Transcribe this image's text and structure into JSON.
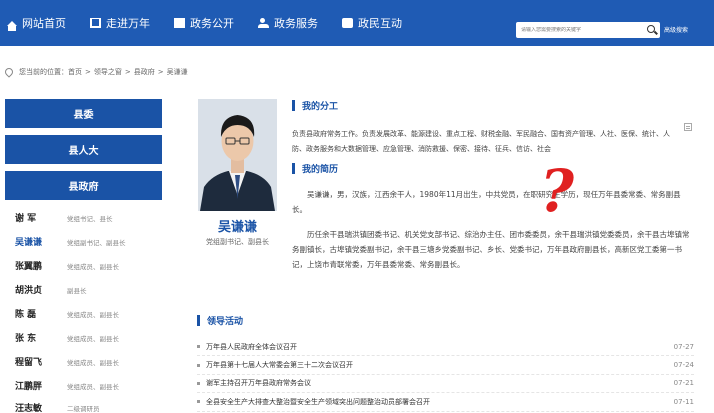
{
  "nav": {
    "items": [
      {
        "label": "网站首页",
        "icon": "home-icon"
      },
      {
        "label": "走进万年",
        "icon": "book-icon"
      },
      {
        "label": "政务公开",
        "icon": "document-icon"
      },
      {
        "label": "政务服务",
        "icon": "people-icon"
      },
      {
        "label": "政民互动",
        "icon": "chat-icon"
      }
    ],
    "search_placeholder": "请输入您需要搜索的关键字",
    "advanced_search": "高级搜索",
    "bg_color": "#1f5bb4"
  },
  "breadcrumb": {
    "prefix": "您当前的位置：",
    "items": [
      "首页",
      "领导之窗",
      "县政府",
      "吴谦谦"
    ]
  },
  "sidebar": {
    "tabs": [
      "县委",
      "县人大",
      "县政府"
    ],
    "leaders": [
      {
        "name": "谢 军",
        "post": "党组书记、县长"
      },
      {
        "name": "吴谦谦",
        "post": "党组副书记、副县长"
      },
      {
        "name": "张翼鹏",
        "post": "党组成员、副县长"
      },
      {
        "name": "胡洪贞",
        "post": "副县长"
      },
      {
        "name": "陈 磊",
        "post": "党组成员、副县长"
      },
      {
        "name": "张 东",
        "post": "党组成员、副县长"
      },
      {
        "name": "程留飞",
        "post": "党组成员、副县长"
      },
      {
        "name": "江鹏胖",
        "post": "党组成员、副县长"
      },
      {
        "name": "汪志敏",
        "post": "二级调研员"
      }
    ],
    "tab_color": "#1a53a6"
  },
  "profile": {
    "name": "吴谦谦",
    "title": "党组副书记、副县长",
    "duty_heading": "我的分工",
    "duty": "负责县政府常务工作。负责发展改革、能源建设、重点工程、财税金融、军民融合、国有资产管理、人社、医保、统计、人防、政务服务和大数据管理、应急管理、消防救援、保密、接待、征兵、信访、社会",
    "resume_heading": "我的简历",
    "resume_p1": "吴谦谦，男，汉族，江西余干人，1980年11月出生，中共党员，在职研究生学历，现任万年县委常委、常务副县长。",
    "resume_p2": "历任余干县瑞洪镇团委书记、机关党支部书记、综治办主任、团市委委员，余干县瑞洪镇党委委员，余干县古埠镇常务副镇长，古埠镇党委副书记，余干县三塘乡党委副书记、乡长、党委书记，万年县政府副县长，高新区党工委第一书记，上饶市青联常委，万年县委常委、常务副县长。"
  },
  "activities": {
    "heading": "领导活动",
    "items": [
      {
        "title": "万年县人民政府全体会议召开",
        "date": "07-27"
      },
      {
        "title": "万年县第十七届人大常委会第三十二次会议召开",
        "date": "07-24"
      },
      {
        "title": "谢军主持召开万年县政府常务会议",
        "date": "07-21"
      },
      {
        "title": "全县安全生产大排查大整治暨安全生产领域突出问题整治动员部署会召开",
        "date": "07-11"
      }
    ]
  },
  "annotation": {
    "mark": "?",
    "color": "#e02020"
  }
}
